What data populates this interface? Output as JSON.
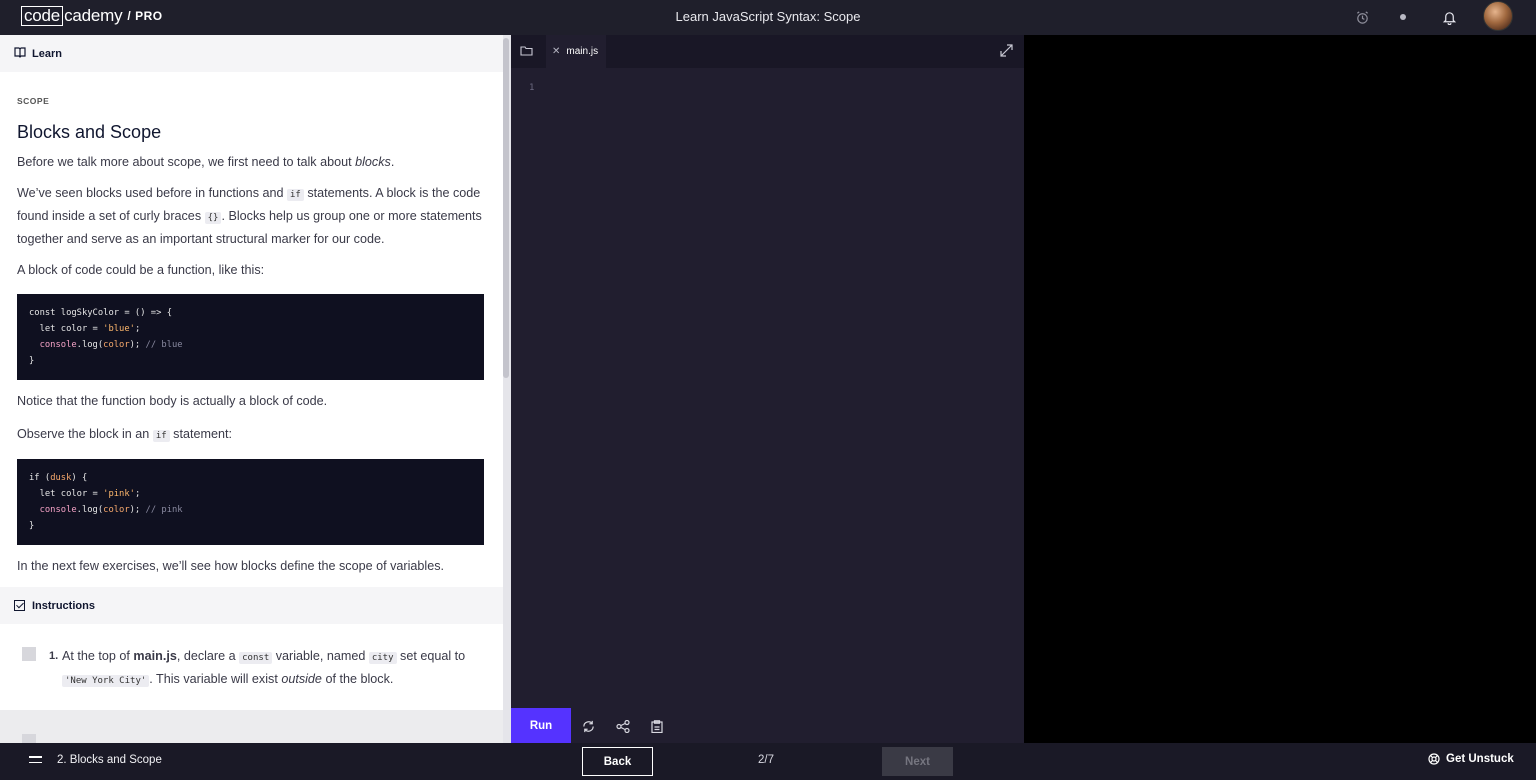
{
  "header": {
    "logo_boxed": "code",
    "logo_rest": "cademy",
    "logo_pro": "/ PRO",
    "title": "Learn JavaScript Syntax: Scope"
  },
  "learn": {
    "header_label": "Learn",
    "kicker": "SCOPE",
    "heading": "Blocks and Scope",
    "p1_before": "Before we talk more about scope, we first need to talk about ",
    "p1_em": "blocks",
    "p1_after": ".",
    "p2_a": "We’ve seen blocks used before in functions and ",
    "p2_code1": "if",
    "p2_b": " statements. A block is the code found inside a set of curly braces ",
    "p2_code2": "{}",
    "p2_c": ". Blocks help us group one or more statements together and serve as an important structural marker for our code.",
    "p3": "A block of code could be a function, like this:",
    "code1": {
      "l1": "const logSkyColor = () => {",
      "l2_a": "  let color = ",
      "l2_str": "'blue'",
      "l2_b": ";",
      "l3_fn": "  console",
      "l3_a": ".log(",
      "l3_var": "color",
      "l3_b": "); ",
      "l3_cm": "// blue",
      "l4": "}"
    },
    "p4": "Notice that the function body is actually a block of code.",
    "p5_a": "Observe the block in an ",
    "p5_code": "if",
    "p5_b": " statement:",
    "code2": {
      "l1_a": "if (",
      "l1_var": "dusk",
      "l1_b": ") {",
      "l2_a": "  let color = ",
      "l2_str": "'pink'",
      "l2_b": ";",
      "l3_fn": "  console",
      "l3_a": ".log(",
      "l3_var": "color",
      "l3_b": "); ",
      "l3_cm": "// pink",
      "l4": "}"
    },
    "p6": "In the next few exercises, we’ll see how blocks define the scope of variables."
  },
  "instructions": {
    "header_label": "Instructions",
    "task1": {
      "number": "1.",
      "a": "At the top of ",
      "bold": "main.js",
      "b": ", declare a ",
      "code1": "const",
      "c": " variable, named ",
      "code2": "city",
      "d": " set equal to ",
      "code3": "'New York City'",
      "e": ". This variable will exist ",
      "em": "outside",
      "f": " of the block."
    }
  },
  "editor": {
    "file_tab": "main.js",
    "line_number": "1",
    "run_label": "Run"
  },
  "footer": {
    "lesson_label": "2. Blocks and Scope",
    "back_label": "Back",
    "progress": "2/7",
    "next_label": "Next",
    "unstuck_label": "Get Unstuck"
  },
  "colors": {
    "accent": "#5533ff",
    "topbar": "#1f1f2b",
    "editor_bg": "#211e2f",
    "output_bg": "#000000"
  },
  "icons": [
    "book-icon",
    "alarm-icon",
    "theme-dot-icon",
    "bell-icon",
    "checkbox-icon",
    "folder-icon",
    "close-icon",
    "expand-icon",
    "refresh-icon",
    "share-icon",
    "clipboard-icon",
    "menu-icon",
    "lifebuoy-icon"
  ]
}
